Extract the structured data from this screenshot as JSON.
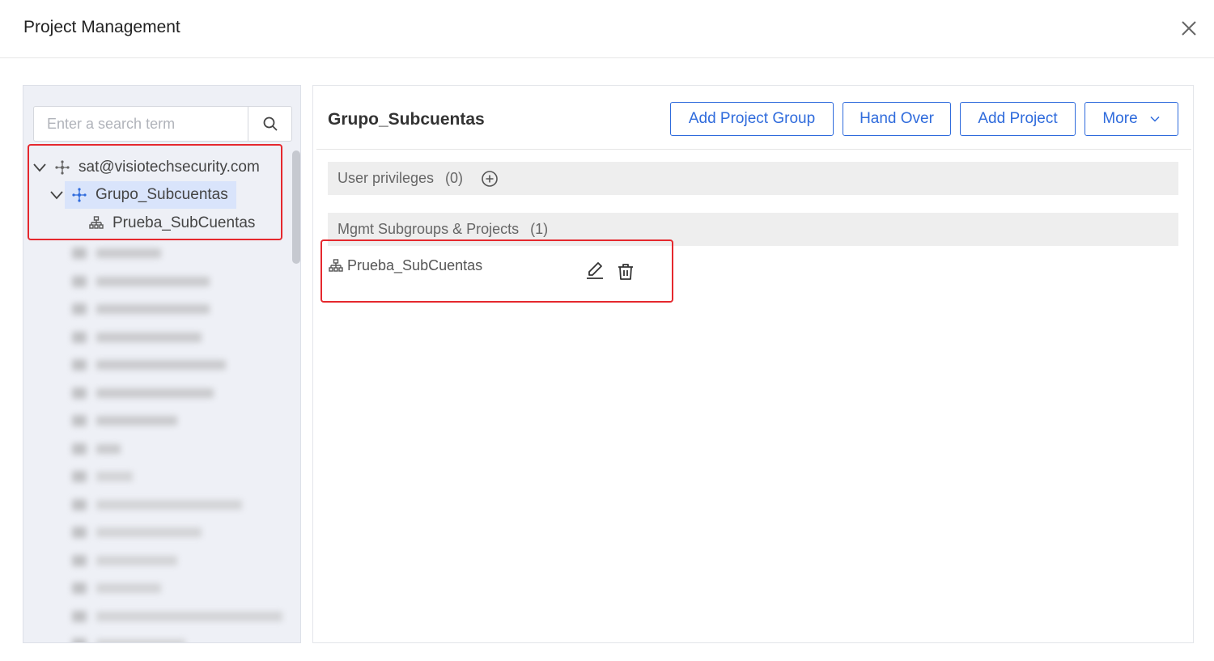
{
  "dialog": {
    "title": "Project Management"
  },
  "search": {
    "placeholder": "Enter a search term"
  },
  "tree": {
    "root": {
      "label": "sat@visiotechsecurity.com"
    },
    "group": {
      "label": "Grupo_Subcuentas"
    },
    "project": {
      "label": "Prueba_SubCuentas"
    }
  },
  "detail": {
    "title": "Grupo_Subcuentas",
    "buttons": {
      "add_group": "Add Project Group",
      "hand_over": "Hand Over",
      "add_project": "Add Project",
      "more": "More"
    },
    "user_privileges": {
      "label": "User privileges",
      "count": "(0)"
    },
    "subgroups": {
      "label": "Mgmt Subgroups & Projects",
      "count": "(1)"
    },
    "items": [
      {
        "label": "Prueba_SubCuentas"
      }
    ]
  },
  "colors": {
    "accent": "#2f6bdc",
    "highlight": "#e5282e",
    "selected": "#d9e4fb"
  }
}
